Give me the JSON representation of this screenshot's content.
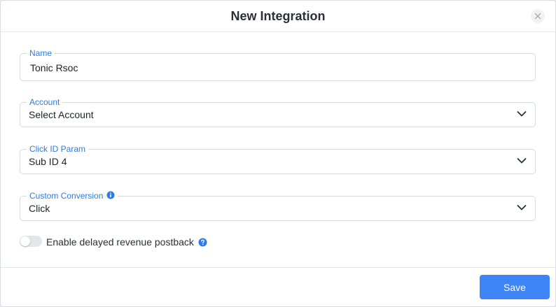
{
  "modal": {
    "title": "New Integration",
    "close_icon": "close-icon"
  },
  "fields": {
    "name": {
      "label": "Name",
      "value": "Tonic Rsoc"
    },
    "account": {
      "label": "Account",
      "value": "Select Account",
      "icon": "chevron-down-icon"
    },
    "click_id_param": {
      "label": "Click ID Param",
      "value": "Sub ID 4",
      "icon": "chevron-down-icon"
    },
    "custom_conversion": {
      "label": "Custom Conversion",
      "value": "Click",
      "info_icon": "info-icon",
      "icon": "chevron-down-icon"
    }
  },
  "toggle": {
    "label": "Enable delayed revenue postback",
    "enabled": false,
    "help_icon": "question-circle-icon"
  },
  "footer": {
    "save_label": "Save"
  },
  "colors": {
    "accent": "#3d84f6",
    "label": "#2f7ae5",
    "text": "#1e2227",
    "border": "#d7dbe0"
  }
}
